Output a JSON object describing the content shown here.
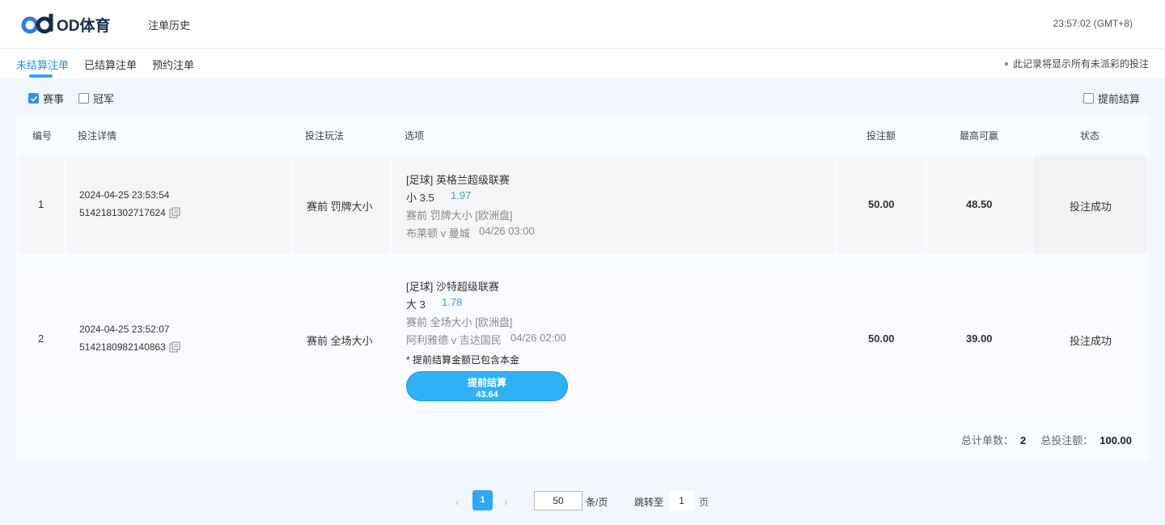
{
  "header": {
    "logo_text": "OD体育",
    "nav_history": "注单历史",
    "clock": "23:57:02 (GMT+8)"
  },
  "tabs": {
    "items": [
      "未结算注单",
      "已结算注单",
      "预约注单"
    ],
    "active_index": 0,
    "note": "此记录将显示所有未派彩的投注"
  },
  "filters": {
    "match_label": "赛事",
    "match_checked": true,
    "champion_label": "冠军",
    "champion_checked": false,
    "cashout_label": "提前结算",
    "cashout_checked": false
  },
  "table": {
    "headers": [
      "编号",
      "投注详情",
      "投注玩法",
      "选项",
      "投注额",
      "最高可赢",
      "状态"
    ],
    "rows": [
      {
        "no": "1",
        "datetime": "2024-04-25 23:53:54",
        "bet_id": "5142181302717624",
        "play": "赛前   罚牌大小",
        "league": "[足球] 英格兰超级联赛",
        "selection": "小 3.5",
        "odds": "1.97",
        "market": "赛前 罚牌大小 [欧洲盘]",
        "match": "布莱顿 v 曼城",
        "match_time": "04/26 03:00",
        "stake": "50.00",
        "max_win": "48.50",
        "status": "投注成功"
      },
      {
        "no": "2",
        "datetime": "2024-04-25 23:52:07",
        "bet_id": "5142180982140863",
        "play": "赛前   全场大小",
        "league": "[足球] 沙特超级联赛",
        "selection": "大 3",
        "odds": "1.78",
        "market": "赛前 全场大小 [欧洲盘]",
        "match": "阿利雅德 v 吉达国民",
        "match_time": "04/26 02:00",
        "stake": "50.00",
        "max_win": "39.00",
        "status": "投注成功",
        "cashout_note": "* 提前结算金额已包含本金",
        "cashout_button": "提前结算",
        "cashout_amount": "43.64"
      }
    ]
  },
  "summary": {
    "count_label": "总计单数：",
    "count_value": "2",
    "total_label": "总投注额：",
    "total_value": "100.00"
  },
  "pagination": {
    "prev_icon": "‹",
    "next_icon": "›",
    "current_page": "1",
    "page_size": "50",
    "page_size_unit": "条/页",
    "jump_label": "跳转至",
    "jump_value": "1",
    "jump_unit": "页"
  },
  "colors": {
    "accent": "#2fa7f3",
    "active_tab": "#2d8fe0",
    "odds": "#3a9ee8",
    "page_bg": "#f2f7fd"
  }
}
